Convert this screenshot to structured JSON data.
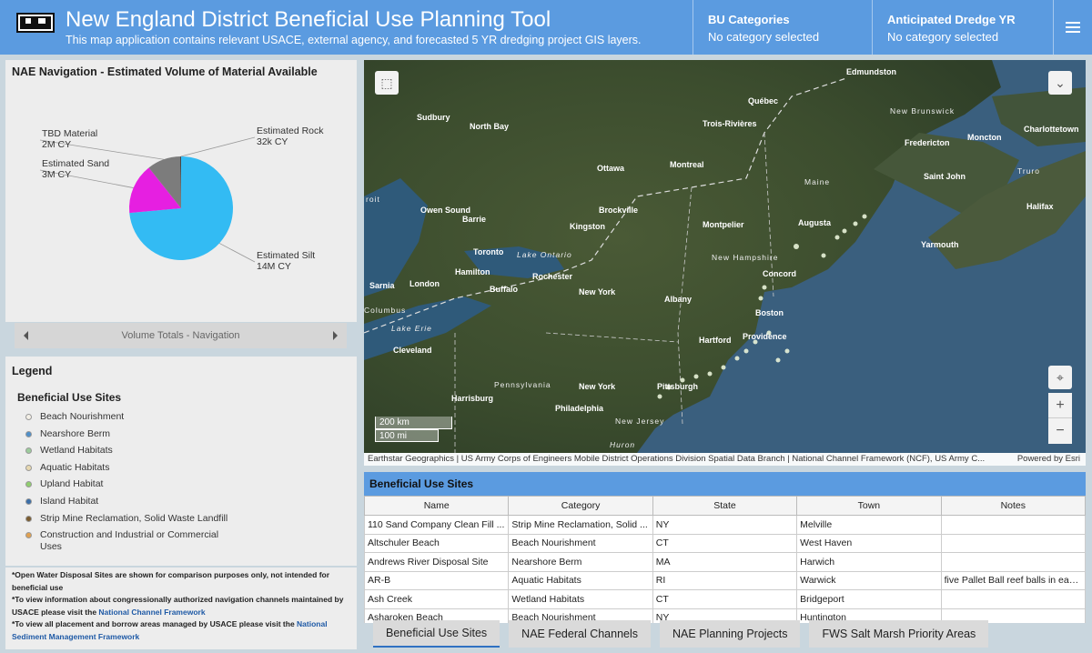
{
  "header": {
    "title": "New England District Beneficial Use Planning Tool",
    "subtitle": "This map application contains relevant USACE, external agency, and forecasted 5 YR dredging project GIS layers.",
    "filters": [
      {
        "label": "BU Categories",
        "value": "No category selected"
      },
      {
        "label": "Anticipated Dredge YR",
        "value": "No category selected"
      }
    ]
  },
  "chart_data": {
    "type": "pie",
    "title": "NAE Navigation - Estimated Volume of Material Available",
    "slices": [
      {
        "label": "Estimated Silt",
        "value_text": "14M CY",
        "value": 14000000,
        "color": "#33bbf3"
      },
      {
        "label": "Estimated Sand",
        "value_text": "3M CY",
        "value": 3000000,
        "color": "#e61fe1"
      },
      {
        "label": "TBD Material",
        "value_text": "2M CY",
        "value": 2000000,
        "color": "#7c7c7c"
      },
      {
        "label": "Estimated Rock",
        "value_text": "32k CY",
        "value": 32000,
        "color": "#111111"
      }
    ]
  },
  "chart_nav": {
    "label": "Volume Totals - Navigation"
  },
  "legend": {
    "title": "Legend",
    "subtitle": "Beneficial Use Sites",
    "items": [
      {
        "label": "Beach Nourishment",
        "color": "#f3efe6"
      },
      {
        "label": "Nearshore Berm",
        "color": "#4f8fc9"
      },
      {
        "label": "Wetland Habitats",
        "color": "#9ccc9c"
      },
      {
        "label": "Aquatic Habitats",
        "color": "#e7d8b0"
      },
      {
        "label": "Upland Habitat",
        "color": "#8fce6e"
      },
      {
        "label": "Island Habitat",
        "color": "#3a6ea8"
      },
      {
        "label": "Strip Mine Reclamation, Solid Waste Landfill",
        "color": "#7a5c30"
      },
      {
        "label": "Construction and Industrial or Commercial Uses",
        "color": "#e0a050"
      }
    ]
  },
  "notes": {
    "line1": "*Open Water Disposal Sites are shown for comparison purposes only, not intended for beneficial use",
    "line2_pre": "*To view information about congressionally authorized navigation channels maintained by USACE please visit the ",
    "line2_link": "National Channel Framework",
    "line3_pre": "*To view all placement and borrow areas managed by USACE please visit the ",
    "line3_link": "National Sediment Management Framework"
  },
  "map": {
    "attribution": "Earthstar Geographics | US Army Corps of Engineers Mobile District Operations Division Spatial Data Branch | National Channel Framework (NCF), US Army C...",
    "powered": "Powered by Esri",
    "scale_km": "200 km",
    "scale_mi": "100 mi",
    "labels": [
      "Edmundston",
      "Québec",
      "Sudbury",
      "North Bay",
      "Trois-Rivières",
      "New Brunswick",
      "Charlottetown",
      "Moncton",
      "Fredericton",
      "Ottawa",
      "Montreal",
      "Maine",
      "Saint John",
      "Truro",
      "Halifax",
      "Owen Sound",
      "Barrie",
      "Brockville",
      "Kingston",
      "Montpelier",
      "Augusta",
      "Toronto",
      "Lake Ontario",
      "Yarmouth",
      "New Hampshire",
      "Hamilton",
      "Rochester",
      "Concord",
      "Sarnia",
      "London",
      "Buffalo",
      "New York",
      "Albany",
      "Boston",
      "Lake Erie",
      "Hartford",
      "Providence",
      "Cleveland",
      "Pennsylvania",
      "New York",
      "Pittsburgh",
      "Harrisburg",
      "Philadelphia",
      "New Jersey",
      "Huron",
      "roit",
      "Columbus"
    ]
  },
  "table": {
    "title": "Beneficial Use Sites",
    "columns": [
      "Name",
      "Category",
      "State",
      "Town",
      "Notes"
    ],
    "rows": [
      [
        "110 Sand Company Clean Fill ...",
        "Strip Mine Reclamation, Solid ...",
        "NY",
        "Melville",
        ""
      ],
      [
        "Altschuler Beach",
        "Beach Nourishment",
        "CT",
        "West Haven",
        ""
      ],
      [
        "Andrews River Disposal Site",
        "Nearshore Berm",
        "MA",
        "Harwich",
        ""
      ],
      [
        "AR-B",
        "Aquatic Habitats",
        "RI",
        "Warwick",
        "five Pallet Ball reef balls in each ..."
      ],
      [
        "Ash Creek",
        "Wetland Habitats",
        "CT",
        "Bridgeport",
        ""
      ],
      [
        "Asharoken Beach",
        "Beach Nourishment",
        "NY",
        "Huntington",
        ""
      ]
    ]
  },
  "tabs": [
    "Beneficial Use Sites",
    "NAE Federal Channels",
    "NAE Planning Projects",
    "FWS Salt Marsh Priority Areas"
  ]
}
